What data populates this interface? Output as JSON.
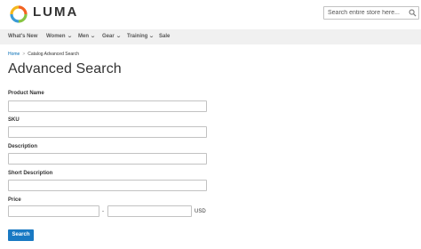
{
  "header": {
    "logo_text": "LUMA",
    "search_placeholder": "Search entire store here..."
  },
  "nav": {
    "items": [
      {
        "label": "What's New",
        "has_dropdown": false
      },
      {
        "label": "Women",
        "has_dropdown": true
      },
      {
        "label": "Men",
        "has_dropdown": true
      },
      {
        "label": "Gear",
        "has_dropdown": true
      },
      {
        "label": "Training",
        "has_dropdown": true
      },
      {
        "label": "Sale",
        "has_dropdown": false
      }
    ],
    "chevron": "⌄"
  },
  "breadcrumb": {
    "home": "Home",
    "separator": ">",
    "current": "Catalog Advanced Search"
  },
  "page": {
    "title": "Advanced Search"
  },
  "form": {
    "product_name_label": "Product Name",
    "sku_label": "SKU",
    "description_label": "Description",
    "short_description_label": "Short Description",
    "price_label": "Price",
    "price_separator": "-",
    "currency": "USD",
    "submit_label": "Search"
  },
  "colors": {
    "accent": "#1979c3",
    "link": "#006bb4",
    "nav_background": "#f0f0f0",
    "logo_orange": "#f26322",
    "logo_yellow": "#f4b71d",
    "logo_green": "#87c542",
    "logo_blue": "#3a9bd6"
  },
  "icons": {
    "logo": "luma-logo-icon",
    "search": "search-icon",
    "dropdown": "chevron-down-icon"
  }
}
